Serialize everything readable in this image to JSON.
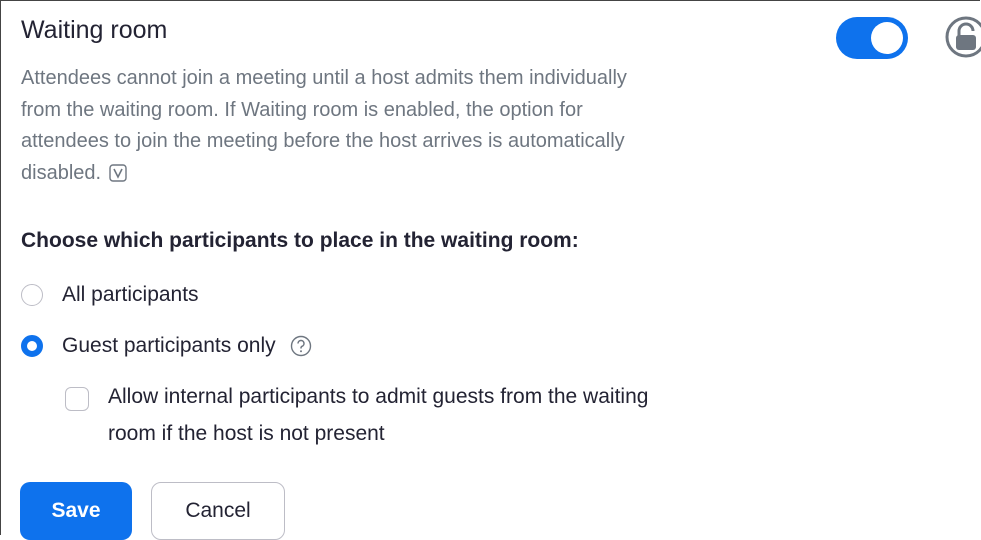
{
  "setting": {
    "title": "Waiting room",
    "enabled": true,
    "description_lines": [
      "Attendees cannot join a meeting until a host admits them individually",
      "from the waiting room. If Waiting room is enabled, the option for",
      "attendees to join the meeting before the host arrives is automatically",
      "disabled."
    ]
  },
  "options": {
    "heading": "Choose which participants to place in the waiting room:",
    "all_participants": "All participants",
    "guest_only": "Guest participants only",
    "selected": "guest_only"
  },
  "allow_internal": {
    "label_lines": [
      "Allow internal participants to admit guests from the waiting",
      "room if the host is not present"
    ],
    "checked": false
  },
  "buttons": {
    "save": "Save",
    "cancel": "Cancel"
  },
  "icons": {
    "toggle": "toggle-switch-on",
    "lock": "unlocked-lock-icon",
    "video": "video-tutorial-icon",
    "help": "question-mark-help-icon"
  },
  "colors": {
    "accent": "#0e72ed",
    "text": "#232333",
    "muted": "#6e7680",
    "border": "#bdbdc6"
  }
}
